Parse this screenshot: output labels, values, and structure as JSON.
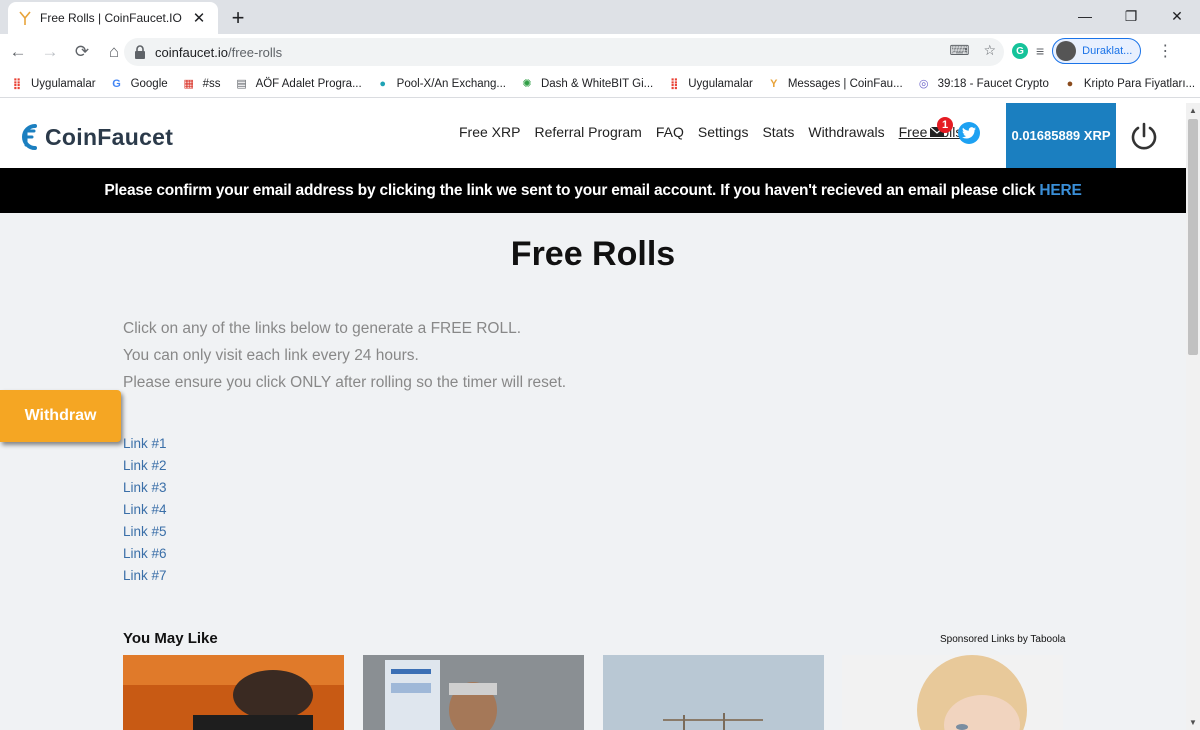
{
  "browser": {
    "tab_title": "Free Rolls | CoinFaucet.IO",
    "url_host": "coinfaucet.io",
    "url_path": "/free-rolls",
    "profile_label": "Duraklat...",
    "bookmarks": [
      {
        "label": "Uygulamalar",
        "icon": "apps-grid-icon"
      },
      {
        "label": "Google",
        "icon": "google-icon"
      },
      {
        "label": "#ss",
        "icon": "calendar-icon"
      },
      {
        "label": "AÖF Adalet Progra...",
        "icon": "document-icon"
      },
      {
        "label": "Pool-X/An Exchang...",
        "icon": "poolx-icon"
      },
      {
        "label": "Dash & WhiteBIT Gi...",
        "icon": "whitebit-icon"
      },
      {
        "label": "Uygulamalar",
        "icon": "apps-grid-icon"
      },
      {
        "label": "Messages | CoinFau...",
        "icon": "faucet-icon"
      },
      {
        "label": "39:18 - Faucet Crypto",
        "icon": "faucetcrypto-icon"
      },
      {
        "label": "Kripto Para Fiyatları...",
        "icon": "coin-icon"
      }
    ]
  },
  "site": {
    "logo_text": "CoinFaucet",
    "nav": [
      "Free XRP",
      "Referral Program",
      "FAQ",
      "Settings",
      "Stats",
      "Withdrawals",
      "Free Rolls"
    ],
    "mail_badge": "1",
    "balance": "0.01685889 XRP"
  },
  "banner": {
    "text": "Please confirm your email address by clicking the link we sent to your email account. If you haven't recieved an email please click",
    "link": "HERE"
  },
  "main": {
    "title": "Free Rolls",
    "intro": [
      "Click on any of the links below to generate a FREE ROLL.",
      "You can only visit each link every 24 hours.",
      "Please ensure you click ONLY after rolling so the timer will reset."
    ],
    "withdraw_label": "Withdraw",
    "links": [
      "Link #1",
      "Link #2",
      "Link #3",
      "Link #4",
      "Link #5",
      "Link #6",
      "Link #7"
    ]
  },
  "recommendations": {
    "heading": "You May Like",
    "sponsored": "Sponsored Links by Taboola"
  },
  "colors": {
    "brand_blue": "#1b7fc0",
    "withdraw_orange": "#f5a623",
    "link_blue": "#3a6fa8"
  }
}
